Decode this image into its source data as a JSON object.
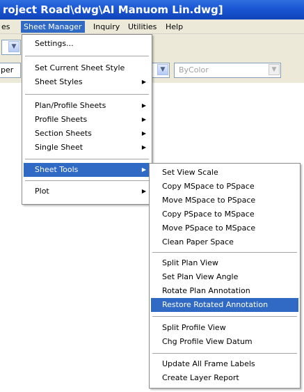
{
  "window": {
    "title": "roject  Road\\dwg\\AI  Manuom  Lin.dwg]"
  },
  "menubar": {
    "items": [
      "es",
      "Sheet Manager",
      "Inquiry",
      "Utilities",
      "Help"
    ],
    "active": "Sheet Manager"
  },
  "toolbar": {
    "layer_combo_text": "per",
    "color_combo_text": "ByColor"
  },
  "sheet_manager_menu": {
    "items": [
      {
        "label": "Settings...",
        "has_submenu": false
      },
      {
        "label": "Set Current Sheet Style",
        "has_submenu": false
      },
      {
        "label": "Sheet Styles",
        "has_submenu": true
      },
      {
        "label": "Plan/Profile Sheets",
        "has_submenu": true
      },
      {
        "label": "Profile Sheets",
        "has_submenu": true
      },
      {
        "label": "Section Sheets",
        "has_submenu": true
      },
      {
        "label": "Single Sheet",
        "has_submenu": true
      },
      {
        "label": "Sheet Tools",
        "has_submenu": true,
        "highlighted": true
      },
      {
        "label": "Plot",
        "has_submenu": true
      }
    ]
  },
  "sheet_tools_menu": {
    "items": [
      {
        "label": "Set View Scale"
      },
      {
        "label": "Copy MSpace to PSpace"
      },
      {
        "label": "Move MSpace to PSpace"
      },
      {
        "label": "Copy PSpace to MSpace"
      },
      {
        "label": "Move PSpace to MSpace"
      },
      {
        "label": "Clean Paper Space"
      },
      {
        "label": "Split Plan View"
      },
      {
        "label": "Set Plan View Angle"
      },
      {
        "label": "Rotate Plan Annotation"
      },
      {
        "label": "Restore Rotated Annotation",
        "highlighted": true
      },
      {
        "label": "Split Profile View"
      },
      {
        "label": "Chg Profile View Datum"
      },
      {
        "label": "Update All Frame Labels"
      },
      {
        "label": "Create Layer Report"
      }
    ]
  },
  "colors": {
    "highlight": "#316ac5",
    "titlebar": "#1a56d4"
  }
}
